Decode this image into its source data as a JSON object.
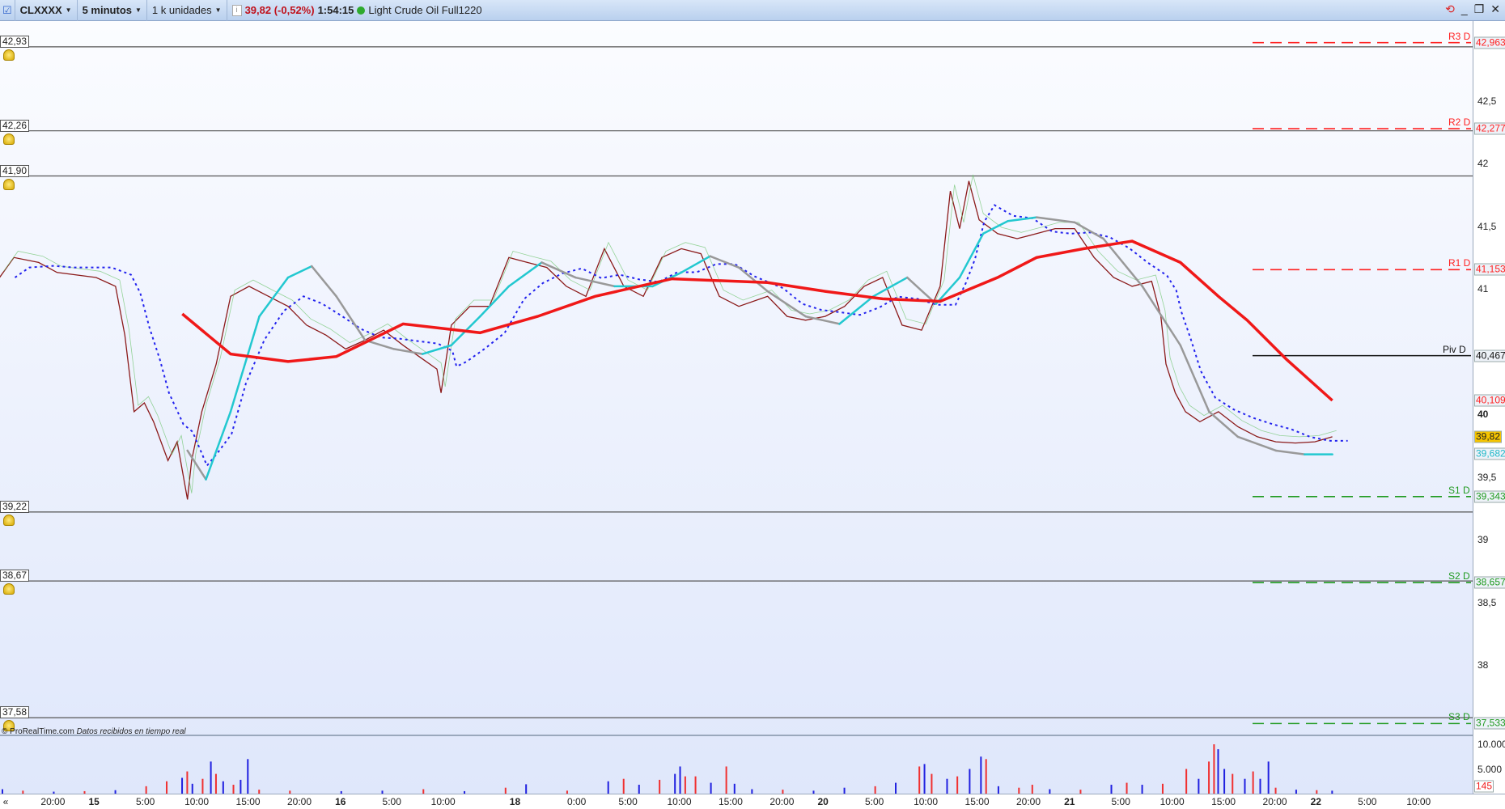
{
  "toolbar": {
    "symbol": "CLXXXX",
    "timeframe": "5 minutos",
    "units": "1 k unidades",
    "price": "39,82 (-0,52%)",
    "time": "1:54:15",
    "instrument": "Light Crude Oil Full1220"
  },
  "credit": {
    "site": "© ProRealTime.com",
    "text": "Datos recibidos en tiempo real"
  },
  "hlines": [
    {
      "label": "42,93",
      "price": 42.93
    },
    {
      "label": "42,26",
      "price": 42.26
    },
    {
      "label": "41,90",
      "price": 41.9
    },
    {
      "label": "39,22",
      "price": 39.22
    },
    {
      "label": "38,67",
      "price": 38.67
    },
    {
      "label": "37,58",
      "price": 37.58
    }
  ],
  "pivots": [
    {
      "name": "R3 D",
      "value": "42,963",
      "price": 42.963,
      "color": "#ff2020"
    },
    {
      "name": "R2 D",
      "value": "42,277",
      "price": 42.277,
      "color": "#ff2020"
    },
    {
      "name": "R1 D",
      "value": "41,153",
      "price": 41.153,
      "color": "#ff2020"
    },
    {
      "name": "Piv D",
      "value": "40,467",
      "price": 40.467,
      "color": "#111111"
    },
    {
      "name": "S1 D",
      "value": "39,343",
      "price": 39.343,
      "color": "#1f9a1f"
    },
    {
      "name": "S2 D",
      "value": "38,657",
      "price": 38.657,
      "color": "#1f9a1f"
    },
    {
      "name": "S3 D",
      "value": "37,533",
      "price": 37.533,
      "color": "#1f9a1f"
    }
  ],
  "y_ticks": [
    {
      "label": "42,5",
      "price": 42.5
    },
    {
      "label": "42",
      "price": 42
    },
    {
      "label": "41,5",
      "price": 41.5
    },
    {
      "label": "41",
      "price": 41
    },
    {
      "label": "40",
      "price": 40,
      "bold": true
    },
    {
      "label": "39,5",
      "price": 39.5
    },
    {
      "label": "39",
      "price": 39
    },
    {
      "label": "38,5",
      "price": 38.5
    },
    {
      "label": "38",
      "price": 38
    }
  ],
  "value_labels": [
    {
      "value": "40,109",
      "price": 40.109,
      "color": "#ff2020",
      "bg": "#eef2f8"
    },
    {
      "value": "39,82",
      "price": 39.82,
      "color": "#222",
      "bg": "#f5c400"
    },
    {
      "value": "39,682",
      "price": 39.682,
      "color": "#20b8c8",
      "bg": "#eef2f8"
    }
  ],
  "volume_axis": [
    {
      "label": "10.000",
      "v": 10000
    },
    {
      "label": "5.000",
      "v": 5000
    }
  ],
  "volume_last": "145",
  "x_ticks": [
    {
      "l": "20:00",
      "t": -4
    },
    {
      "l": "15",
      "t": 0,
      "b": 1
    },
    {
      "l": "5:00",
      "t": 5
    },
    {
      "l": "10:00",
      "t": 10
    },
    {
      "l": "15:00",
      "t": 15
    },
    {
      "l": "20:00",
      "t": 20
    },
    {
      "l": "16",
      "t": 24,
      "b": 1
    },
    {
      "l": "5:00",
      "t": 29
    },
    {
      "l": "10:00",
      "t": 34
    },
    {
      "l": "18",
      "t": 41,
      "b": 1
    },
    {
      "l": "0:00",
      "t": 47
    },
    {
      "l": "5:00",
      "t": 52
    },
    {
      "l": "10:00",
      "t": 57
    },
    {
      "l": "15:00",
      "t": 62
    },
    {
      "l": "20:00",
      "t": 67
    },
    {
      "l": "20",
      "t": 71,
      "b": 1
    },
    {
      "l": "5:00",
      "t": 76
    },
    {
      "l": "10:00",
      "t": 81
    },
    {
      "l": "15:00",
      "t": 86
    },
    {
      "l": "20:00",
      "t": 91
    },
    {
      "l": "21",
      "t": 95,
      "b": 1
    },
    {
      "l": "5:00",
      "t": 100
    },
    {
      "l": "10:00",
      "t": 105
    },
    {
      "l": "15:00",
      "t": 110
    },
    {
      "l": "20:00",
      "t": 115
    },
    {
      "l": "22",
      "t": 119,
      "b": 1
    },
    {
      "l": "5:00",
      "t": 124
    },
    {
      "l": "10:00",
      "t": 129
    }
  ],
  "chart_data": {
    "type": "line",
    "price": [
      [
        -9.2,
        41.09
      ],
      [
        -7.8,
        41.25
      ],
      [
        -5.4,
        41.21
      ],
      [
        -3.6,
        41.13
      ],
      [
        0.2,
        41.09
      ],
      [
        2.1,
        41.02
      ],
      [
        3.0,
        40.63
      ],
      [
        3.9,
        40.02
      ],
      [
        4.9,
        40.09
      ],
      [
        5.8,
        39.94
      ],
      [
        7.2,
        39.63
      ],
      [
        8.1,
        39.78
      ],
      [
        9.1,
        39.32
      ],
      [
        9.5,
        39.63
      ],
      [
        10.5,
        40.02
      ],
      [
        11.9,
        40.4
      ],
      [
        13.3,
        40.94
      ],
      [
        15.1,
        41.02
      ],
      [
        17.0,
        40.94
      ],
      [
        18.9,
        40.86
      ],
      [
        20.7,
        40.71
      ],
      [
        22.6,
        40.63
      ],
      [
        24.5,
        40.52
      ],
      [
        26.4,
        40.59
      ],
      [
        28.2,
        40.67
      ],
      [
        30.1,
        40.55
      ],
      [
        32.0,
        40.44
      ],
      [
        33.4,
        40.36
      ],
      [
        33.8,
        40.17
      ],
      [
        34.8,
        40.71
      ],
      [
        36.6,
        40.86
      ],
      [
        38.5,
        40.86
      ],
      [
        40.4,
        41.25
      ],
      [
        42.2,
        41.21
      ],
      [
        44.1,
        41.17
      ],
      [
        46.0,
        41.02
      ],
      [
        47.9,
        40.94
      ],
      [
        49.7,
        41.32
      ],
      [
        51.6,
        41.02
      ],
      [
        53.5,
        40.94
      ],
      [
        55.3,
        41.25
      ],
      [
        57.2,
        41.32
      ],
      [
        59.1,
        41.28
      ],
      [
        60.9,
        40.94
      ],
      [
        62.8,
        40.86
      ],
      [
        65.6,
        40.94
      ],
      [
        67.5,
        40.78
      ],
      [
        69.3,
        40.75
      ],
      [
        71.2,
        40.78
      ],
      [
        73.1,
        40.86
      ],
      [
        75.0,
        41.02
      ],
      [
        76.8,
        41.09
      ],
      [
        78.7,
        40.71
      ],
      [
        80.6,
        40.67
      ],
      [
        82.4,
        41.02
      ],
      [
        83.4,
        41.78
      ],
      [
        84.3,
        41.48
      ],
      [
        85.2,
        41.86
      ],
      [
        86.2,
        41.55
      ],
      [
        88.0,
        41.44
      ],
      [
        89.9,
        41.4
      ],
      [
        91.8,
        41.44
      ],
      [
        93.6,
        41.48
      ],
      [
        95.5,
        41.48
      ],
      [
        97.4,
        41.25
      ],
      [
        99.3,
        41.09
      ],
      [
        101.1,
        41.02
      ],
      [
        103.0,
        41.06
      ],
      [
        103.9,
        40.78
      ],
      [
        104.4,
        40.4
      ],
      [
        105.3,
        40.17
      ],
      [
        106.3,
        40.02
      ],
      [
        107.7,
        39.94
      ],
      [
        109.5,
        40.02
      ],
      [
        111.4,
        39.9
      ],
      [
        113.3,
        39.82
      ],
      [
        115.1,
        39.78
      ],
      [
        117.0,
        39.77
      ],
      [
        118.9,
        39.78
      ],
      [
        120.6,
        39.82
      ]
    ],
    "ma_red": [
      [
        8.6,
        40.8
      ],
      [
        13.3,
        40.48
      ],
      [
        18.9,
        40.42
      ],
      [
        23.6,
        40.46
      ],
      [
        30.1,
        40.72
      ],
      [
        37.6,
        40.65
      ],
      [
        43.2,
        40.78
      ],
      [
        48.8,
        40.94
      ],
      [
        56.3,
        41.08
      ],
      [
        65.6,
        41.05
      ],
      [
        71.2,
        40.98
      ],
      [
        76.8,
        40.92
      ],
      [
        82.4,
        40.9
      ],
      [
        88.0,
        41.09
      ],
      [
        91.8,
        41.25
      ],
      [
        96.4,
        41.32
      ],
      [
        101.1,
        41.38
      ],
      [
        105.8,
        41.21
      ],
      [
        109.5,
        40.94
      ],
      [
        112.3,
        40.75
      ],
      [
        116.1,
        40.44
      ],
      [
        120.6,
        40.11
      ]
    ],
    "ma_cyan": [
      [
        9.1,
        39.71
      ],
      [
        10.9,
        39.48
      ],
      [
        13.3,
        40.02
      ],
      [
        16.1,
        40.78
      ],
      [
        18.9,
        41.09
      ],
      [
        21.2,
        41.18
      ],
      [
        23.6,
        40.94
      ],
      [
        26.4,
        40.59
      ],
      [
        29.2,
        40.52
      ],
      [
        32.0,
        40.48
      ],
      [
        34.8,
        40.55
      ],
      [
        37.6,
        40.78
      ],
      [
        40.4,
        41.02
      ],
      [
        43.6,
        41.21
      ],
      [
        46.9,
        41.09
      ],
      [
        50.7,
        41.02
      ],
      [
        54.4,
        41.02
      ],
      [
        57.2,
        41.13
      ],
      [
        60.0,
        41.26
      ],
      [
        62.8,
        41.17
      ],
      [
        65.6,
        40.98
      ],
      [
        69.3,
        40.78
      ],
      [
        72.6,
        40.72
      ],
      [
        75.9,
        40.94
      ],
      [
        79.2,
        41.09
      ],
      [
        82.0,
        40.88
      ],
      [
        84.3,
        41.09
      ],
      [
        86.6,
        41.44
      ],
      [
        89.0,
        41.54
      ],
      [
        91.8,
        41.57
      ],
      [
        95.5,
        41.53
      ],
      [
        98.3,
        41.4
      ],
      [
        102.1,
        41.02
      ],
      [
        105.8,
        40.55
      ],
      [
        108.6,
        40.02
      ],
      [
        111.4,
        39.82
      ],
      [
        115.1,
        39.71
      ],
      [
        117.9,
        39.68
      ],
      [
        120.6,
        39.68
      ]
    ],
    "volume": [
      [
        -9,
        900,
        "b"
      ],
      [
        -7,
        600,
        "r"
      ],
      [
        -4,
        400,
        "b"
      ],
      [
        -1,
        500,
        "r"
      ],
      [
        2,
        700,
        "b"
      ],
      [
        5,
        1500,
        "r"
      ],
      [
        7,
        2500,
        "r"
      ],
      [
        8.5,
        3200,
        "b"
      ],
      [
        9,
        4500,
        "r"
      ],
      [
        9.5,
        2000,
        "b"
      ],
      [
        10.5,
        3000,
        "r"
      ],
      [
        11.3,
        6500,
        "b"
      ],
      [
        11.8,
        4000,
        "r"
      ],
      [
        12.5,
        2500,
        "b"
      ],
      [
        13.5,
        1800,
        "r"
      ],
      [
        14.2,
        2800,
        "b"
      ],
      [
        14.9,
        7000,
        "b"
      ],
      [
        16,
        800,
        "r"
      ],
      [
        19,
        600,
        "r"
      ],
      [
        24,
        500,
        "b"
      ],
      [
        28,
        600,
        "b"
      ],
      [
        32,
        900,
        "r"
      ],
      [
        36,
        500,
        "b"
      ],
      [
        40,
        1200,
        "r"
      ],
      [
        42,
        1900,
        "b"
      ],
      [
        46,
        600,
        "r"
      ],
      [
        50,
        2500,
        "b"
      ],
      [
        51.5,
        3000,
        "r"
      ],
      [
        53,
        1800,
        "b"
      ],
      [
        55,
        2800,
        "r"
      ],
      [
        56.5,
        4000,
        "b"
      ],
      [
        57,
        5500,
        "b"
      ],
      [
        57.5,
        3500,
        "r"
      ],
      [
        58.5,
        3500,
        "r"
      ],
      [
        60,
        2200,
        "b"
      ],
      [
        61.5,
        5500,
        "r"
      ],
      [
        62.3,
        2000,
        "b"
      ],
      [
        64,
        900,
        "b"
      ],
      [
        67,
        800,
        "r"
      ],
      [
        70,
        600,
        "b"
      ],
      [
        73,
        1200,
        "b"
      ],
      [
        76,
        1500,
        "r"
      ],
      [
        78,
        2200,
        "b"
      ],
      [
        80.3,
        5500,
        "r"
      ],
      [
        80.8,
        6000,
        "b"
      ],
      [
        81.5,
        4000,
        "r"
      ],
      [
        83,
        3000,
        "b"
      ],
      [
        84,
        3500,
        "r"
      ],
      [
        85.2,
        5000,
        "b"
      ],
      [
        86.3,
        7500,
        "b"
      ],
      [
        86.8,
        7000,
        "r"
      ],
      [
        88,
        1500,
        "b"
      ],
      [
        90,
        1200,
        "r"
      ],
      [
        91.3,
        1800,
        "r"
      ],
      [
        93,
        900,
        "b"
      ],
      [
        96,
        800,
        "r"
      ],
      [
        99,
        1800,
        "b"
      ],
      [
        100.5,
        2200,
        "r"
      ],
      [
        102,
        1800,
        "b"
      ],
      [
        104,
        2000,
        "r"
      ],
      [
        106.3,
        5000,
        "r"
      ],
      [
        107.5,
        3000,
        "b"
      ],
      [
        108.5,
        6500,
        "r"
      ],
      [
        109,
        10000,
        "r"
      ],
      [
        109.4,
        9000,
        "b"
      ],
      [
        110,
        5000,
        "b"
      ],
      [
        110.8,
        4000,
        "r"
      ],
      [
        112,
        3000,
        "b"
      ],
      [
        112.8,
        4500,
        "r"
      ],
      [
        113.5,
        3000,
        "b"
      ],
      [
        114.3,
        6500,
        "b"
      ],
      [
        115,
        1200,
        "r"
      ],
      [
        117,
        800,
        "b"
      ],
      [
        119,
        700,
        "r"
      ],
      [
        120.5,
        600,
        "b"
      ]
    ]
  }
}
